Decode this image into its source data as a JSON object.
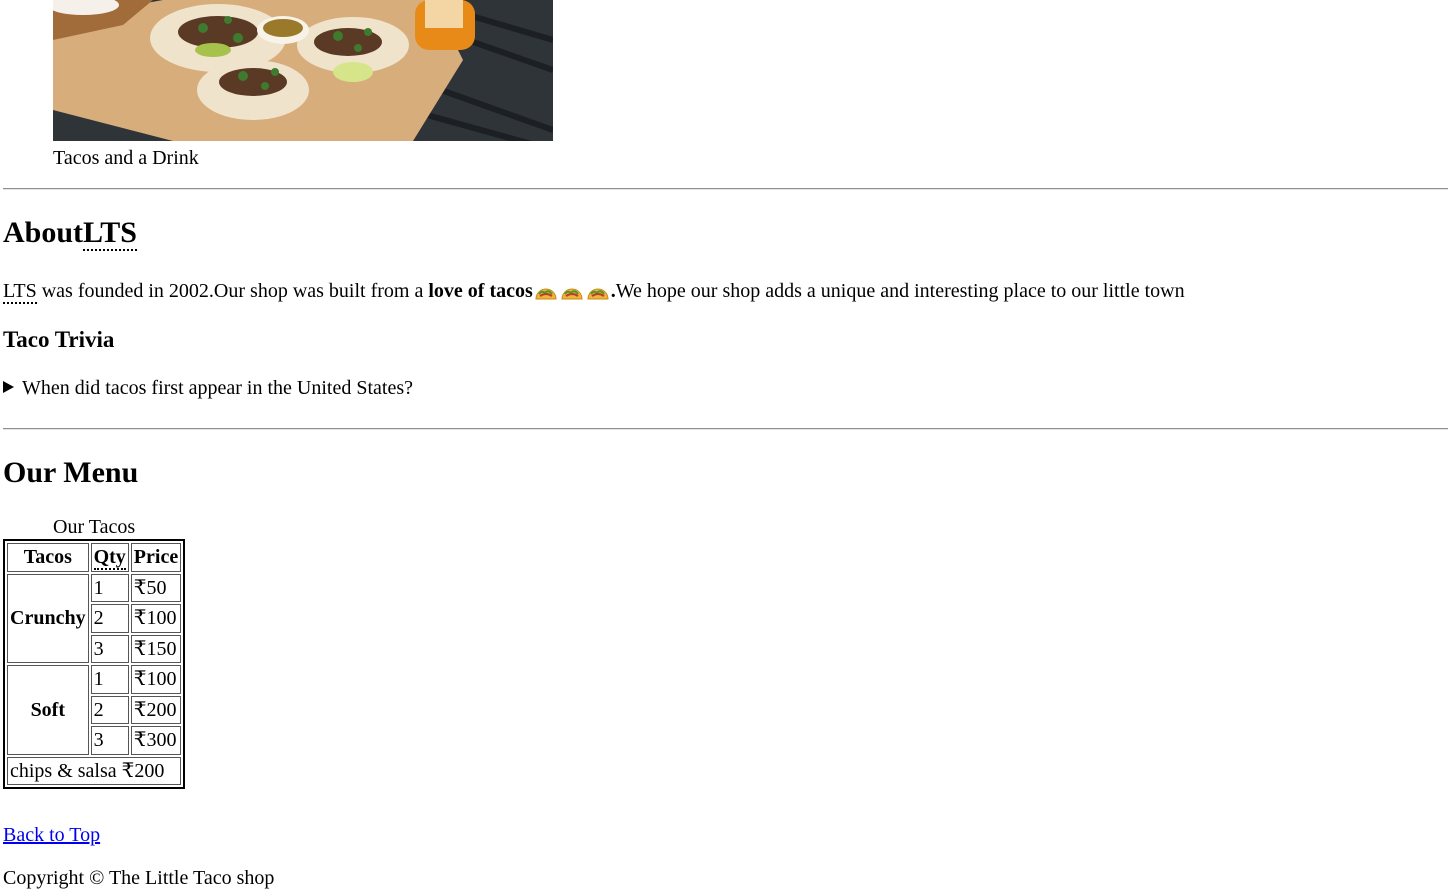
{
  "photo": {
    "caption": "Tacos and a Drink"
  },
  "about": {
    "heading_prefix": "About",
    "heading_abbr": "LTS",
    "para_abbr": "LTS",
    "para_text1": " was founded in 2002.Our shop was built from a ",
    "para_bold": "love of tacos",
    "para_period": ".",
    "para_text2": "We hope our shop adds a unique and interesting place to our little town"
  },
  "trivia": {
    "heading": "Taco Trivia",
    "summary": "When did tacos first appear in the United States?"
  },
  "menu": {
    "heading": "Our Menu",
    "caption": "Our Tacos",
    "headers": [
      "Tacos",
      "Qty",
      "Price"
    ],
    "groups": [
      {
        "name": "Crunchy",
        "rows": [
          [
            "1",
            "₹50"
          ],
          [
            "2",
            "₹100"
          ],
          [
            "3",
            "₹150"
          ]
        ]
      },
      {
        "name": "Soft",
        "rows": [
          [
            "1",
            "₹100"
          ],
          [
            "2",
            "₹200"
          ],
          [
            "3",
            "₹300"
          ]
        ]
      }
    ],
    "footer": "chips & salsa ₹200"
  },
  "back_to_top": "Back to Top",
  "copyright": "Copyright © The Little Taco shop",
  "colors": {
    "link": "#0000ee",
    "rule": "#8f8f8f"
  }
}
